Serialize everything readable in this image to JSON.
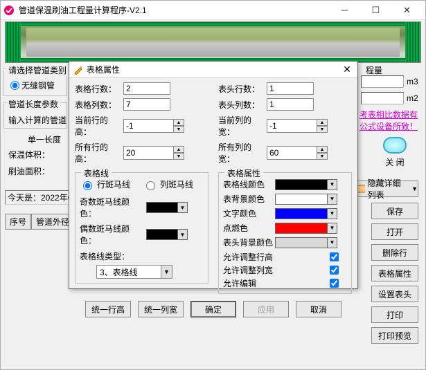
{
  "window": {
    "title": "管道保温刷油工程量计算程序-V2.1",
    "date_line": "今天是：2022年6"
  },
  "bg": {
    "fs_type_label": "请选择管道类别",
    "radio_seamless": "无缝钢管",
    "fs_length_label": "管道长度参数",
    "length_input_label": "输入计算的管道",
    "fs_single_label": "单一长度",
    "row_insul_vol": "保温体积：",
    "row_paint_area": "刷油面积：",
    "fs_qty_label": "程量",
    "unit_m3": "m3",
    "unit_m2": "m2",
    "link_text": "考表相比数据有\n公式设备所致！",
    "table_col1": "序号",
    "table_col2": "管道外径"
  },
  "right_buttons": {
    "close": "关 闭",
    "hide_detail": "隐藏详细列表",
    "save": "保存",
    "open": "打开",
    "delrow": "删除行",
    "tblprop": "表格属性",
    "sethead": "设置表头",
    "print": "打印",
    "preview": "打印预览"
  },
  "dialog": {
    "title": "表格属性",
    "rows_label": "表格行数：",
    "rows_val": "2",
    "cols_label": "表格列数：",
    "cols_val": "7",
    "hdr_rows_label": "表头行数：",
    "hdr_rows_val": "1",
    "hdr_cols_label": "表头列数：",
    "hdr_cols_val": "1",
    "cur_row_h_label": "当前行的高：",
    "cur_row_h_val": "-1",
    "cur_col_w_label": "当前列的宽：",
    "cur_col_w_val": "-1",
    "all_row_h_label": "所有行的高：",
    "all_row_h_val": "20",
    "all_col_w_label": "所有列的宽：",
    "all_col_w_val": "60",
    "fs_lines": "表格线",
    "radio_row_zebra": "行斑马线",
    "radio_col_zebra": "列斑马线",
    "odd_zebra_color": "奇数斑马线颜色：",
    "even_zebra_color": "偶数斑马线颜色：",
    "line_type_label": "表格线类型：",
    "line_type_val": "3、表格线",
    "fs_props": "表格属性",
    "grid_line_color": "表格线颜色",
    "bg_color": "表背景颜色",
    "text_color": "文字颜色",
    "focus_color": "点燃色",
    "header_bg_color": "表头背景颜色",
    "allow_rowh": "允许调整行高",
    "allow_colw": "允许调整列宽",
    "allow_edit": "允许编辑",
    "btn_unify_rowh": "统一行高",
    "btn_unify_colw": "统一列宽",
    "btn_ok": "确定",
    "btn_apply": "应用",
    "btn_cancel": "取消",
    "colors": {
      "odd": "#000000",
      "even": "#000000",
      "grid": "#000000",
      "bg": "#ffffff",
      "text": "#0000ff",
      "focus": "#ff0000",
      "header": "#d8d8d8"
    }
  }
}
